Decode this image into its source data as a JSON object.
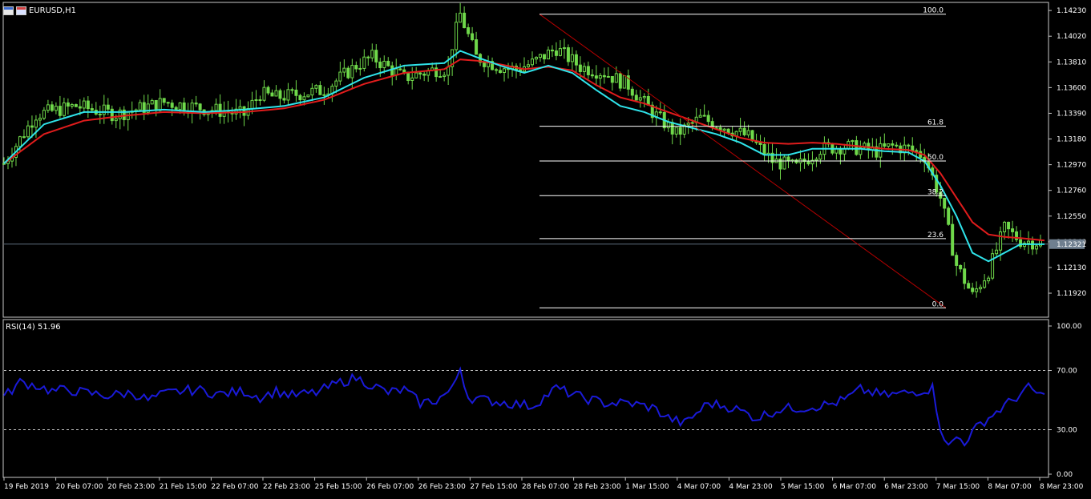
{
  "window": {
    "title": "EURUSD,H1",
    "icons": [
      "chart-window-icon",
      "restore-window-icon"
    ]
  },
  "colors": {
    "background": "#000000",
    "frame": "#c8c8c8",
    "bull_candle": "#6fd84a",
    "bear_candle": "#6fd84a",
    "fast_ma": "#2fe3ea",
    "slow_ma": "#e01c1c",
    "fibo_trend": "#b30000",
    "fibo_levels": "#ffffff",
    "current_price_line": "#5e6e7e",
    "price_tag_bg": "#6f7f8f",
    "rsi_line": "#1a1ad8"
  },
  "chart_data": [
    {
      "type": "candlestick",
      "symbol": "EURUSD",
      "timeframe": "H1",
      "ylim": [
        1.1175,
        1.1427
      ],
      "y_ticks": [
        "1.14230",
        "1.14020",
        "1.13810",
        "1.13600",
        "1.13390",
        "1.13180",
        "1.12970",
        "1.12760",
        "1.12550",
        "1.12340",
        "1.12130",
        "1.11920"
      ],
      "x_ticks": [
        "19 Feb 2019",
        "20 Feb 07:00",
        "20 Feb 23:00",
        "21 Feb 15:00",
        "22 Feb 07:00",
        "22 Feb 23:00",
        "25 Feb 15:00",
        "26 Feb 07:00",
        "26 Feb 23:00",
        "27 Feb 15:00",
        "28 Feb 07:00",
        "28 Feb 23:00",
        "1 Mar 15:00",
        "4 Mar 07:00",
        "4 Mar 23:00",
        "5 Mar 15:00",
        "6 Mar 07:00",
        "6 Mar 23:00",
        "7 Mar 15:00",
        "8 Mar 07:00",
        "8 Mar 23:00"
      ],
      "current_price": 1.12321,
      "current_price_label": "1.12321",
      "price_path_x": [
        0,
        8,
        18,
        28,
        40,
        52,
        60,
        64,
        68,
        80,
        88,
        92,
        100,
        108,
        111,
        112,
        114,
        118,
        124,
        128,
        132,
        138,
        144,
        150,
        156,
        162,
        168,
        174,
        180,
        186,
        192,
        198,
        204,
        210,
        214,
        218,
        222,
        226,
        230,
        234,
        238,
        242,
        246,
        250,
        254,
        260
      ],
      "price_path_y": [
        1.1298,
        1.1338,
        1.1345,
        1.1338,
        1.1348,
        1.1342,
        1.1338,
        1.1355,
        1.1352,
        1.1358,
        1.1378,
        1.1385,
        1.1368,
        1.1375,
        1.1375,
        1.1395,
        1.142,
        1.1385,
        1.1377,
        1.1375,
        1.138,
        1.1392,
        1.1377,
        1.1372,
        1.1362,
        1.134,
        1.1322,
        1.1335,
        1.1328,
        1.132,
        1.13,
        1.1295,
        1.131,
        1.1312,
        1.131,
        1.1308,
        1.1312,
        1.131,
        1.1304,
        1.127,
        1.1215,
        1.119,
        1.121,
        1.1245,
        1.1235,
        1.1233
      ],
      "fast_ma_x": [
        0,
        10,
        20,
        30,
        40,
        50,
        60,
        70,
        80,
        90,
        100,
        110,
        114,
        118,
        124,
        130,
        136,
        142,
        148,
        154,
        160,
        166,
        172,
        178,
        184,
        190,
        196,
        202,
        208,
        214,
        220,
        226,
        230,
        234,
        238,
        242,
        246,
        250,
        254,
        260
      ],
      "fast_ma_y": [
        1.1298,
        1.133,
        1.134,
        1.134,
        1.1342,
        1.134,
        1.1342,
        1.1345,
        1.1352,
        1.1368,
        1.1378,
        1.138,
        1.139,
        1.1385,
        1.1378,
        1.1372,
        1.1378,
        1.1372,
        1.1358,
        1.1345,
        1.134,
        1.1332,
        1.1327,
        1.1322,
        1.1315,
        1.1305,
        1.1305,
        1.131,
        1.131,
        1.131,
        1.1308,
        1.1307,
        1.13,
        1.128,
        1.1255,
        1.1225,
        1.1218,
        1.1225,
        1.1232,
        1.1232
      ],
      "slow_ma_x": [
        0,
        10,
        20,
        30,
        40,
        50,
        60,
        70,
        80,
        90,
        100,
        110,
        114,
        118,
        124,
        130,
        136,
        142,
        148,
        154,
        160,
        166,
        172,
        178,
        184,
        190,
        196,
        202,
        208,
        214,
        220,
        226,
        230,
        234,
        238,
        242,
        246,
        250,
        254,
        260
      ],
      "slow_ma_y": [
        1.1298,
        1.1322,
        1.1333,
        1.1337,
        1.134,
        1.1339,
        1.134,
        1.1343,
        1.135,
        1.1363,
        1.1372,
        1.1375,
        1.1383,
        1.1382,
        1.1379,
        1.1375,
        1.1377,
        1.1374,
        1.1362,
        1.1352,
        1.1347,
        1.134,
        1.1333,
        1.1326,
        1.1319,
        1.1315,
        1.1314,
        1.1315,
        1.1314,
        1.1312,
        1.131,
        1.1309,
        1.1305,
        1.129,
        1.127,
        1.125,
        1.124,
        1.1238,
        1.1237,
        1.1235
      ],
      "fibonacci": {
        "high": 1.142,
        "low": 1.118,
        "levels": [
          {
            "label": "100.0",
            "price": 1.142
          },
          {
            "label": "61.8",
            "price": 1.13284
          },
          {
            "label": "50.0",
            "price": 1.13
          },
          {
            "label": "38.2",
            "price": 1.12717
          },
          {
            "label": "23.6",
            "price": 1.12366
          },
          {
            "label": "0.0",
            "price": 1.118
          }
        ]
      }
    },
    {
      "type": "line",
      "title": "RSI(14) 51.96",
      "ylim": [
        0,
        100
      ],
      "y_ticks": [
        "100.00",
        "70.00",
        "30.00",
        "0.00"
      ],
      "levels": [
        70,
        30
      ],
      "rsi_x": [
        0,
        4,
        8,
        12,
        16,
        20,
        26,
        32,
        36,
        40,
        44,
        48,
        54,
        60,
        64,
        68,
        72,
        78,
        84,
        88,
        92,
        96,
        100,
        104,
        108,
        112,
        114,
        116,
        120,
        126,
        132,
        138,
        144,
        150,
        156,
        162,
        166,
        170,
        176,
        182,
        188,
        194,
        200,
        206,
        210,
        214,
        220,
        226,
        232,
        234,
        236,
        238,
        240,
        244,
        248,
        252,
        256,
        260
      ],
      "rsi_y": [
        52,
        62,
        60,
        56,
        57,
        55,
        53,
        55,
        50,
        54,
        56,
        57,
        54,
        56,
        52,
        56,
        53,
        55,
        62,
        65,
        60,
        55,
        57,
        48,
        50,
        57,
        72,
        52,
        50,
        48,
        46,
        58,
        52,
        48,
        48,
        45,
        38,
        34,
        48,
        45,
        38,
        44,
        45,
        47,
        50,
        57,
        53,
        55,
        58,
        32,
        18,
        25,
        22,
        34,
        42,
        50,
        58,
        52
      ]
    }
  ]
}
